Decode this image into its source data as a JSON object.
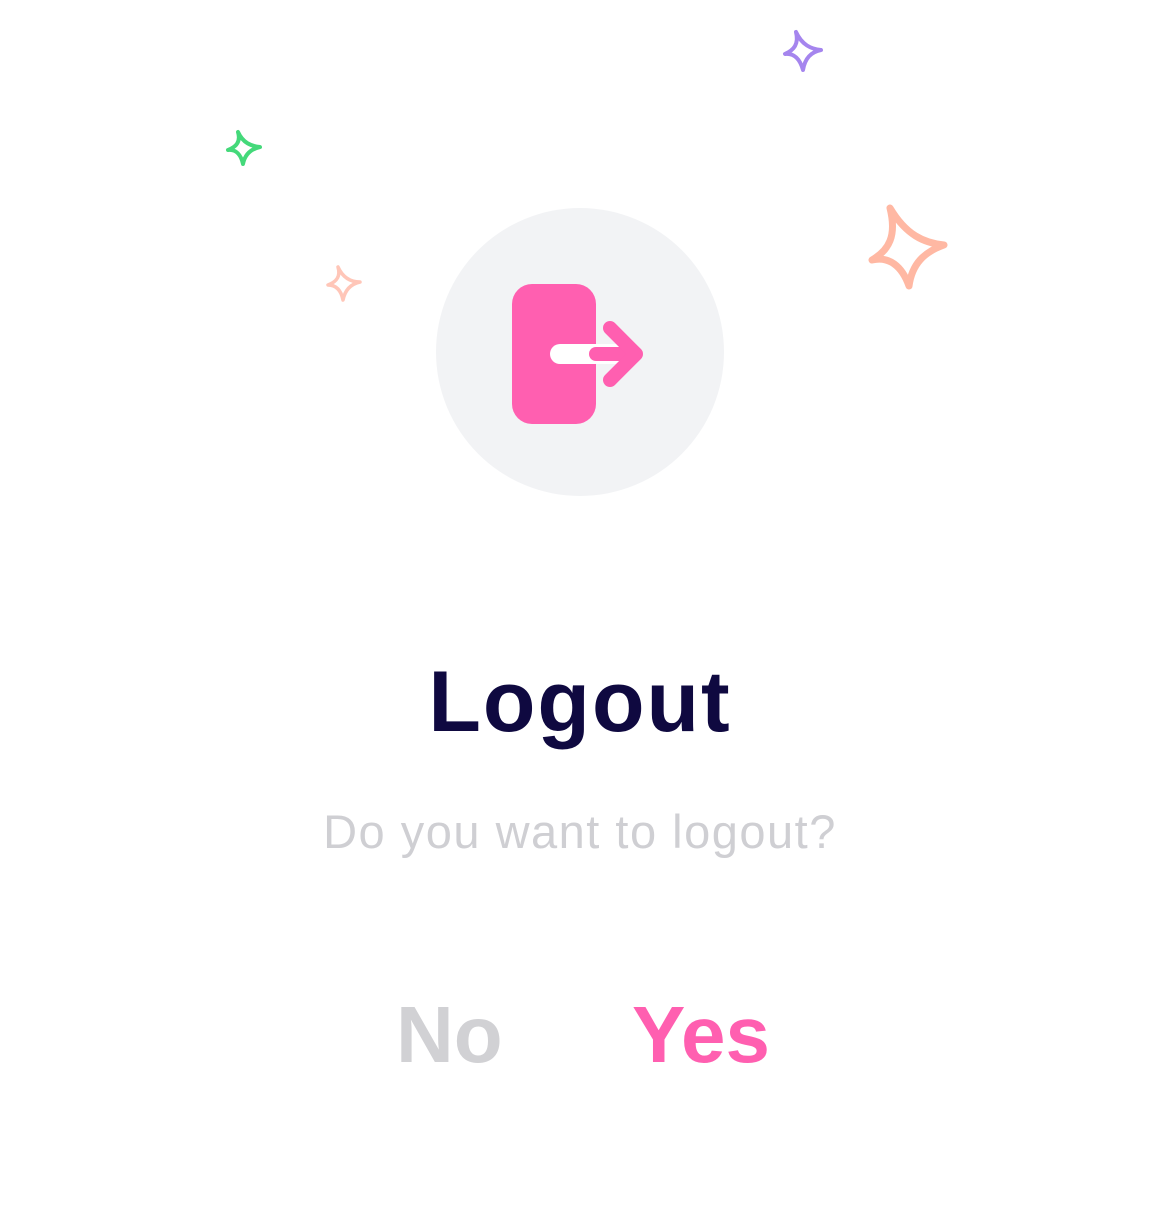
{
  "dialog": {
    "title": "Logout",
    "message": "Do you want to logout?",
    "no_label": "No",
    "yes_label": "Yes",
    "icon": "logout-icon"
  },
  "colors": {
    "accent": "#ff5fb0",
    "title": "#0f0940",
    "muted": "#cfcfd3",
    "icon_background": "#f2f3f5",
    "sparkle_green": "#44d97a",
    "sparkle_purple": "#a585ee",
    "sparkle_peach": "#ffb8a3",
    "sparkle_light_peach": "#ffc6b8"
  }
}
